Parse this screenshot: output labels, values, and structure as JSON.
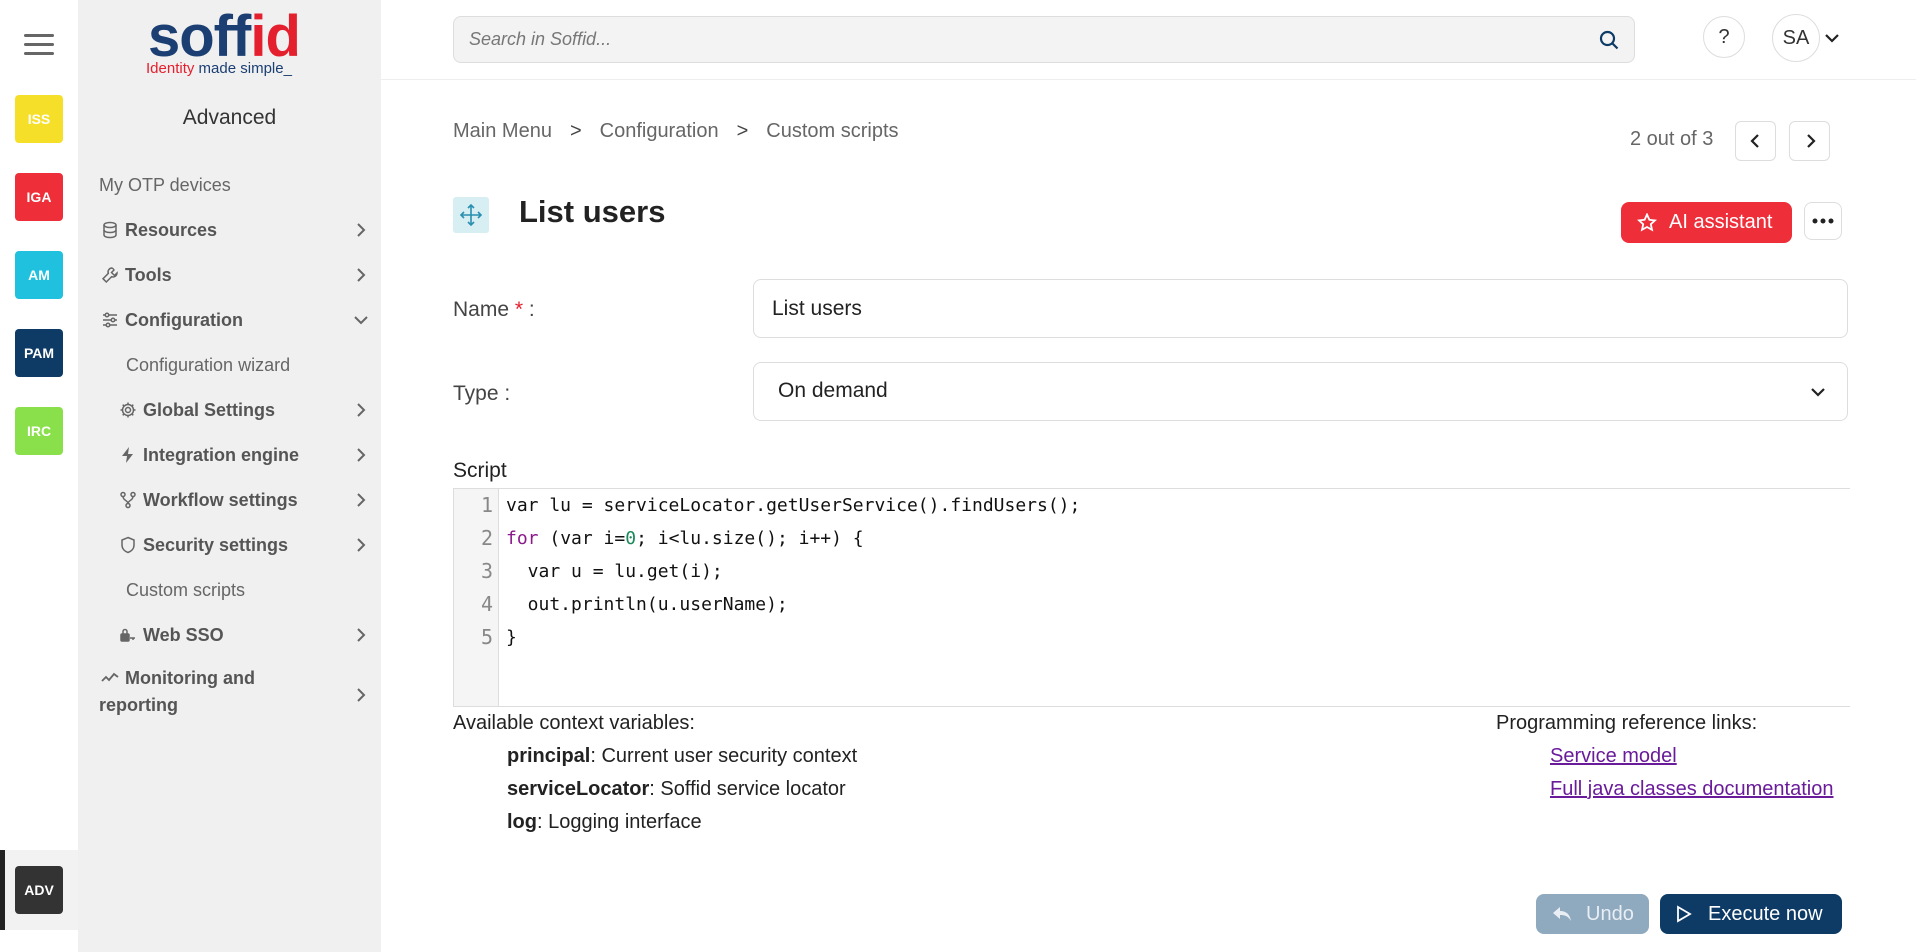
{
  "app": {
    "logo_main": "soff",
    "logo_accent": "id",
    "logo_tag_1": "Identity",
    "logo_tag_2": "made simple_",
    "brand_red": "#e4202e",
    "brand_blue": "#1b3f73"
  },
  "rail": {
    "apps": [
      {
        "label": "ISS",
        "color": "#f6df28"
      },
      {
        "label": "IGA",
        "color": "#ee2f3a"
      },
      {
        "label": "AM",
        "color": "#1fc1de"
      },
      {
        "label": "PAM",
        "color": "#0d3b66"
      },
      {
        "label": "IRC",
        "color": "#8ae04a"
      }
    ],
    "active_app": {
      "label": "ADV",
      "color": "#333333"
    }
  },
  "sidebar": {
    "title": "Advanced",
    "items": [
      {
        "label": "My OTP devices"
      },
      {
        "label": "Resources",
        "icon": "database-icon"
      },
      {
        "label": "Tools",
        "icon": "wrench-icon"
      },
      {
        "label": "Configuration",
        "icon": "sliders-icon"
      },
      {
        "label": "Configuration wizard"
      },
      {
        "label": "Global Settings",
        "icon": "gear-icon"
      },
      {
        "label": "Integration engine",
        "icon": "bolt-icon"
      },
      {
        "label": "Workflow settings",
        "icon": "workflow-icon"
      },
      {
        "label": "Security settings",
        "icon": "shield-icon"
      },
      {
        "label": "Custom scripts"
      },
      {
        "label": "Web SSO",
        "icon": "lock-key-icon"
      },
      {
        "label_1": "Monitoring and",
        "label_2": "reporting",
        "icon": "chart-line-icon"
      }
    ]
  },
  "topbar": {
    "search_placeholder": "Search in Soffid...",
    "help_label": "?",
    "user_initials": "SA"
  },
  "breadcrumb": [
    "Main Menu",
    ">",
    "Configuration",
    ">",
    "Custom scripts"
  ],
  "pager": {
    "text": "2 out of 3"
  },
  "page": {
    "title": "List users",
    "ai_button": "AI assistant"
  },
  "form": {
    "name_label": "Name",
    "required_mark": "*",
    "label_suffix": " :",
    "name_value": "List users",
    "type_label": "Type :",
    "type_value": "On demand",
    "script_label": "Script"
  },
  "editor": {
    "line_numbers": [
      "1",
      "2",
      "3",
      "4",
      "5"
    ],
    "lines": [
      "var lu = serviceLocator.getUserService().findUsers();",
      "for (var i=0; i<lu.size(); i++) {",
      "  var u = lu.get(i);",
      "  out.println(u.userName);",
      "}"
    ]
  },
  "context": {
    "title": "Available context variables:",
    "vars": [
      {
        "name": "principal",
        "desc": ": Current user security context"
      },
      {
        "name": "serviceLocator",
        "desc": ": Soffid service locator"
      },
      {
        "name": "log",
        "desc": ": Logging interface"
      }
    ]
  },
  "references": {
    "title": "Programming reference links:",
    "links": [
      "Service model",
      "Full java classes documentation"
    ]
  },
  "actions": {
    "undo": "Undo",
    "execute": "Execute now"
  }
}
